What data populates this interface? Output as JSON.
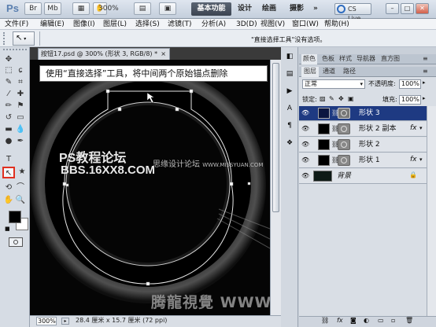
{
  "titlebar": {
    "logo": "Ps",
    "zoom_value": "300%",
    "workspaces": [
      "基本功能",
      "设计",
      "绘画",
      "摄影"
    ],
    "more": "»",
    "cslive": "CS Live"
  },
  "menubar": {
    "items": [
      "文件(F)",
      "编辑(E)",
      "图像(I)",
      "图层(L)",
      "选择(S)",
      "滤镜(T)",
      "分析(A)",
      "3D(D)",
      "视图(V)",
      "窗口(W)",
      "帮助(H)"
    ]
  },
  "options_bar": {
    "hint": "\"直接选择工具\"没有选项。"
  },
  "document": {
    "tab_title": "按钮17.psd @ 300% (形状 3, RGB/8) *",
    "tab_close": "×",
    "callout": "使用“直接选择”工具，将中间两个原始锚点删除",
    "zoom": "300%",
    "info": "28.4 厘米 x 15.7 厘米 (72 ppi)"
  },
  "watermarks": {
    "bbs_line1": "PS教程论坛",
    "bbs_line2": "BBS.16XX8.COM",
    "site_a": "思缘设计论坛",
    "site_b": "WWW.MISSYUAN.COM",
    "bottom": "腾龍視覺 WWW.TLVI.NET"
  },
  "panels": {
    "tabs_top": [
      "颜色",
      "色板",
      "样式",
      "导航器",
      "直方图"
    ],
    "tabs_layers": [
      "图层",
      "通道",
      "路径"
    ],
    "blend_mode": "正常",
    "opacity_label": "不透明度:",
    "opacity_value": "100%",
    "lock_label": "锁定:",
    "fill_label": "填充:",
    "fill_value": "100%",
    "layers": [
      {
        "name": "形状 3",
        "selected": true,
        "fx": false
      },
      {
        "name": "形状 2 副本",
        "selected": false,
        "fx": true
      },
      {
        "name": "形状 2",
        "selected": false,
        "fx": false
      },
      {
        "name": "形状 1",
        "selected": false,
        "fx": true
      },
      {
        "name": "背景",
        "selected": false,
        "fx": false
      }
    ],
    "fx_label": "fx",
    "lock_icon": "🔒"
  },
  "colors": {
    "accent": "#1e3a82",
    "workspace_active": "#3c4451"
  }
}
